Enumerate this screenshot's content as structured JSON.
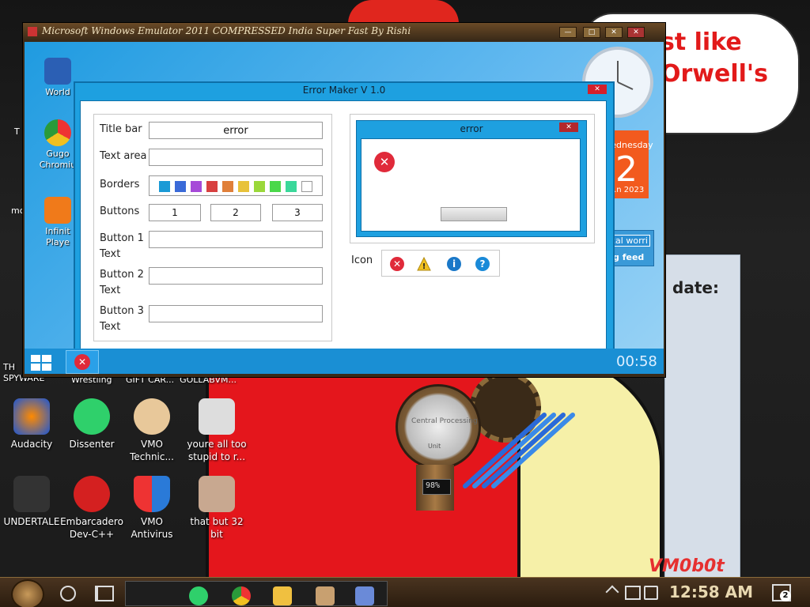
{
  "background": {
    "speech_text": "st like\nOrwell's",
    "panel_text": "date:",
    "watermark": "VM0b0t",
    "gauge_label_top": "Central Processing",
    "gauge_label_bottom": "Unit",
    "gauge_percent": "98%"
  },
  "desktop_icons": [
    {
      "label": "Audacity",
      "color": "#1a56d6"
    },
    {
      "label": "Dissenter",
      "color": "#2fd06b"
    },
    {
      "label": "VMO Technic...",
      "color": "#e8c89a"
    },
    {
      "label": "youre all too stupid to r...",
      "color": "#dddddd"
    },
    {
      "label": "UNDERTALE",
      "color": "#333333"
    },
    {
      "label": "Embarcadero Dev-C++",
      "color": "#d42020"
    },
    {
      "label": "VMO Antivirus",
      "color": "#2a7ad8"
    },
    {
      "label": "that but 32 bit",
      "color": "#c8a890"
    }
  ],
  "partial_labels": {
    "row_above": "Wrestling     GIFT CAR...  GOLLABVM...",
    "spyware": "TH SPYWARE",
    "mc": "mc",
    "t": "T"
  },
  "emulator": {
    "title": "Microsoft Windows Emulator 2011 COMPRESSED India Super Fast By Rishi",
    "ctl_min": "—",
    "ctl_max": "□",
    "ctl_close": "✕",
    "ctl_extra": "✕",
    "desktop_icons": [
      {
        "label": "World",
        "color": "#2b5fb4"
      },
      {
        "label": "Gugo Chromiu",
        "color": "#e33"
      },
      {
        "label": "Infinit Playe",
        "color": "#f07a1a"
      }
    ],
    "calendar_day": "Wednesday",
    "calendar_num": "2",
    "calendar_month": "...n 2023",
    "feed_line1": "cal worri",
    "feed_line2": "g feed",
    "taskbar_time": "00:58"
  },
  "error_maker": {
    "title": "Error Maker V 1.0",
    "close": "✕",
    "labels": {
      "title_bar": "Title bar",
      "text_area": "Text area",
      "borders": "Borders",
      "buttons": "Buttons",
      "button1_text": "Button 1\nText",
      "button2_text": "Button 2\nText",
      "button3_text": "Button 3\nText",
      "icon": "Icon"
    },
    "fields": {
      "title_bar_value": "error",
      "text_area_value": "",
      "button1_text_value": "",
      "button2_text_value": "",
      "button3_text_value": ""
    },
    "button_choices": [
      "1",
      "2",
      "3"
    ],
    "border_colors": [
      "#1a9ad6",
      "#3a6ad8",
      "#a64ad8",
      "#d84040",
      "#e0803a",
      "#e8c23a",
      "#9ad83a",
      "#4ad84a",
      "#3ad89a",
      "#ffffff"
    ],
    "preview": {
      "title": "error",
      "close": "✕",
      "icon": "error"
    },
    "icons": [
      {
        "name": "error",
        "glyph": "✕",
        "color": "#e02a3a"
      },
      {
        "name": "warning",
        "glyph": "!",
        "color": "#f0c020"
      },
      {
        "name": "info",
        "glyph": "i",
        "color": "#1a78c8"
      },
      {
        "name": "question",
        "glyph": "?",
        "color": "#1a8ad8"
      }
    ]
  },
  "taskbar": {
    "time": "12:58 AM",
    "notification_count": "2",
    "apps": [
      {
        "name": "Spotify-like",
        "color": "#2fd06b"
      },
      {
        "name": "Chrome",
        "color": "#e33"
      },
      {
        "name": "File Explorer",
        "color": "#f0c040"
      },
      {
        "name": "Picture",
        "color": "#c8a070"
      },
      {
        "name": "VirtualBox",
        "color": "#6a8ad8"
      }
    ]
  }
}
